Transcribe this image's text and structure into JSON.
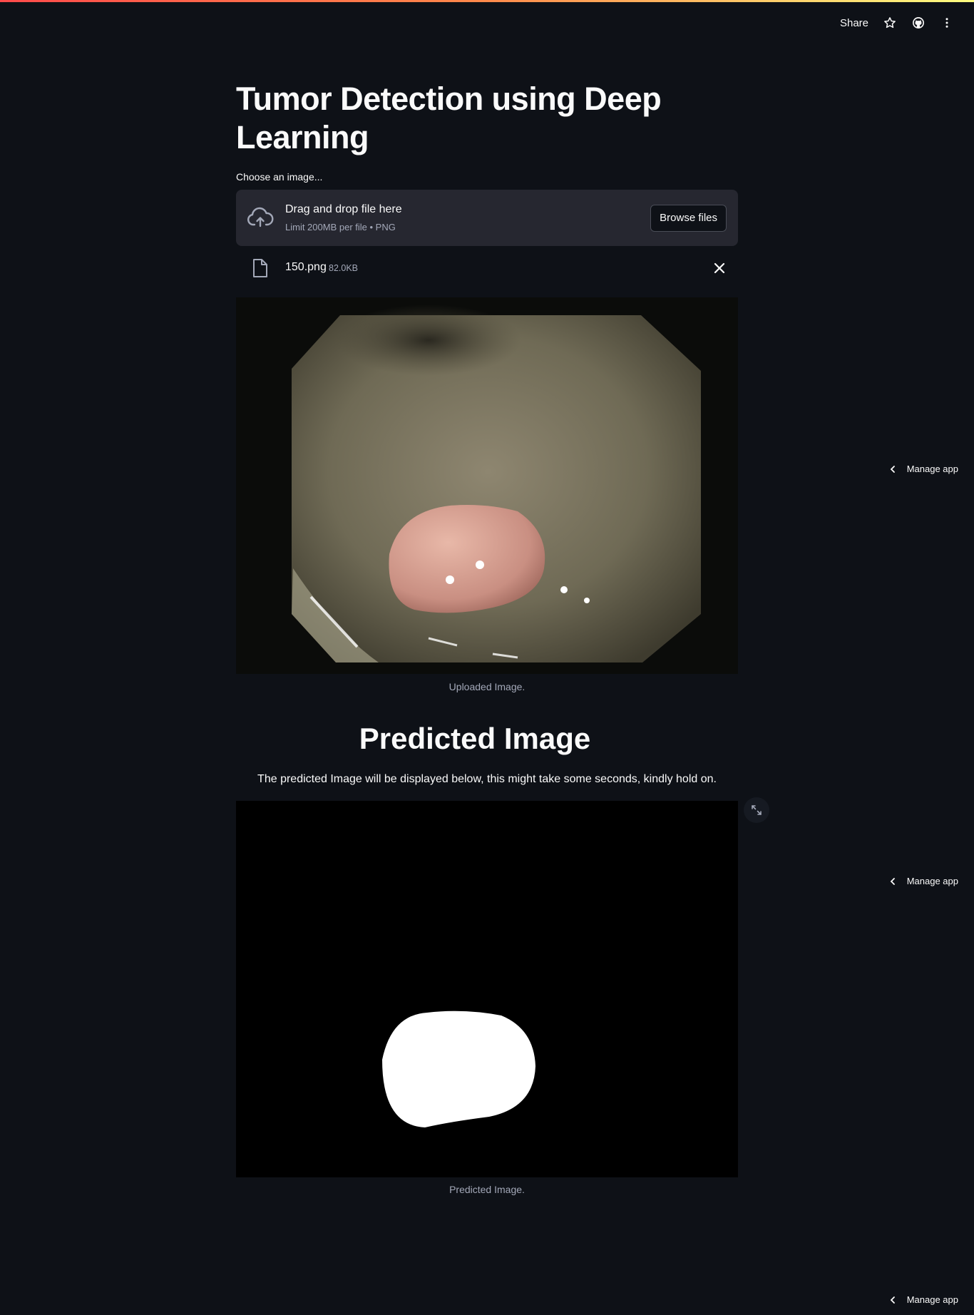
{
  "header": {
    "share_label": "Share",
    "icons": [
      "star-icon",
      "github-icon",
      "more-vertical-icon"
    ]
  },
  "page": {
    "title": "Tumor Detection using Deep Learning"
  },
  "uploader": {
    "label": "Choose an image...",
    "dropzone_title": "Drag and drop file here",
    "dropzone_limit": "Limit 200MB per file • PNG",
    "browse_label": "Browse files",
    "file_name": "150.png",
    "file_size": "82.0KB"
  },
  "uploaded_image": {
    "caption": "Uploaded Image."
  },
  "prediction": {
    "heading": "Predicted Image",
    "description": "The predicted Image will be displayed below, this might take some seconds, kindly hold on.",
    "caption": "Predicted Image."
  },
  "manage_app": {
    "label": "Manage app"
  },
  "colors": {
    "background": "#0e1117",
    "panel": "#262730",
    "accent_gradient": [
      "#ff4b4b",
      "#fffd80"
    ]
  }
}
